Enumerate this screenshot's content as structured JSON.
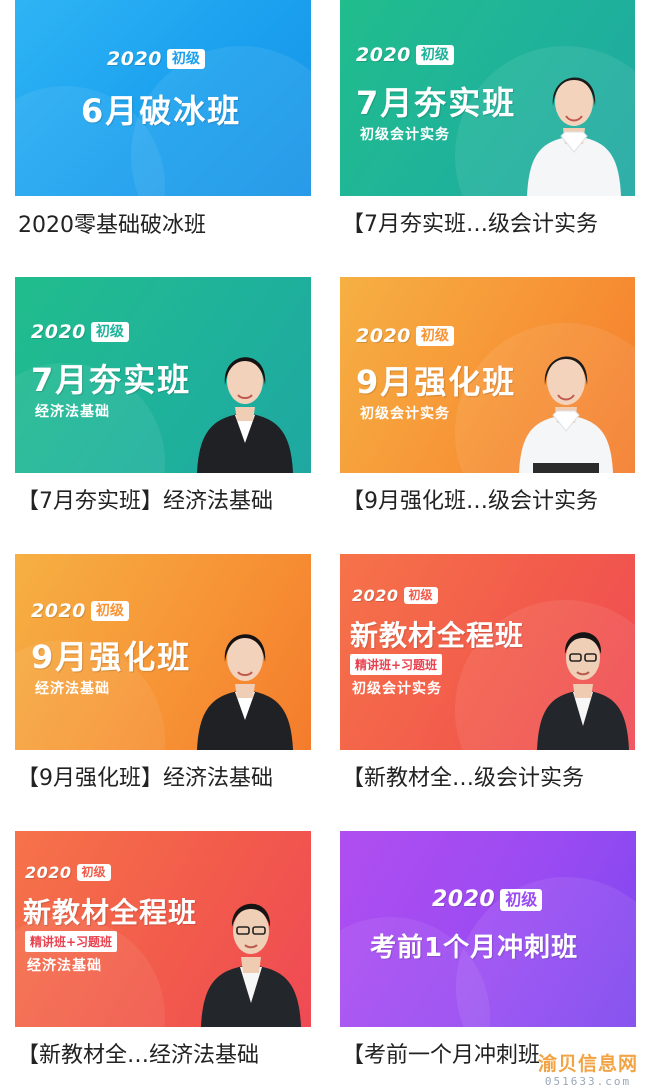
{
  "cards": [
    {
      "caption": "2020零基础破冰班",
      "banner": {
        "year": "2020",
        "level": "初级",
        "title": "6月破冰班",
        "subtitle": "",
        "badge": ""
      },
      "theme": {
        "color": "#1aa0ee",
        "has_teacher": false
      }
    },
    {
      "caption": "【7月夯实班…级会计实务",
      "banner": {
        "year": "2020",
        "level": "初级",
        "title": "7月夯实班",
        "subtitle": "初级会计实务",
        "badge": ""
      },
      "theme": {
        "color": "#1fb39a",
        "has_teacher": true,
        "teacher_outfit": "white"
      }
    },
    {
      "caption": "【7月夯实班】经济法基础",
      "banner": {
        "year": "2020",
        "level": "初级",
        "title": "7月夯实班",
        "subtitle": "经济法基础",
        "badge": ""
      },
      "theme": {
        "color": "#1fb39a",
        "has_teacher": true,
        "teacher_outfit": "suit"
      }
    },
    {
      "caption": "【9月强化班…级会计实务",
      "banner": {
        "year": "2020",
        "level": "初级",
        "title": "9月强化班",
        "subtitle": "初级会计实务",
        "badge": ""
      },
      "theme": {
        "color": "#f79436",
        "has_teacher": true,
        "teacher_outfit": "white"
      }
    },
    {
      "caption": "【9月强化班】经济法基础",
      "banner": {
        "year": "2020",
        "level": "初级",
        "title": "9月强化班",
        "subtitle": "经济法基础",
        "badge": ""
      },
      "theme": {
        "color": "#f79436",
        "has_teacher": true,
        "teacher_outfit": "suit"
      }
    },
    {
      "caption": "【新教材全…级会计实务",
      "banner": {
        "year": "2020",
        "level": "初级",
        "title": "新教材全程班",
        "subtitle": "初级会计实务",
        "badge": "精讲班+习题班"
      },
      "theme": {
        "color": "#f25b4b",
        "has_teacher": true,
        "teacher_outfit": "suit-glasses"
      }
    },
    {
      "caption": "【新教材全…经济法基础",
      "banner": {
        "year": "2020",
        "level": "初级",
        "title": "新教材全程班",
        "subtitle": "经济法基础",
        "badge": "精讲班+习题班"
      },
      "theme": {
        "color": "#f25b4b",
        "has_teacher": true,
        "teacher_outfit": "suit-glasses"
      }
    },
    {
      "caption": "【考前一个月冲刺班",
      "banner": {
        "year": "2020",
        "level": "初级",
        "title": "考前1个月冲刺班",
        "subtitle": "",
        "badge": ""
      },
      "theme": {
        "color": "#9a4bf2",
        "has_teacher": false
      }
    }
  ],
  "watermark": {
    "brand": "渝贝信息网",
    "domain": "051633.com"
  }
}
